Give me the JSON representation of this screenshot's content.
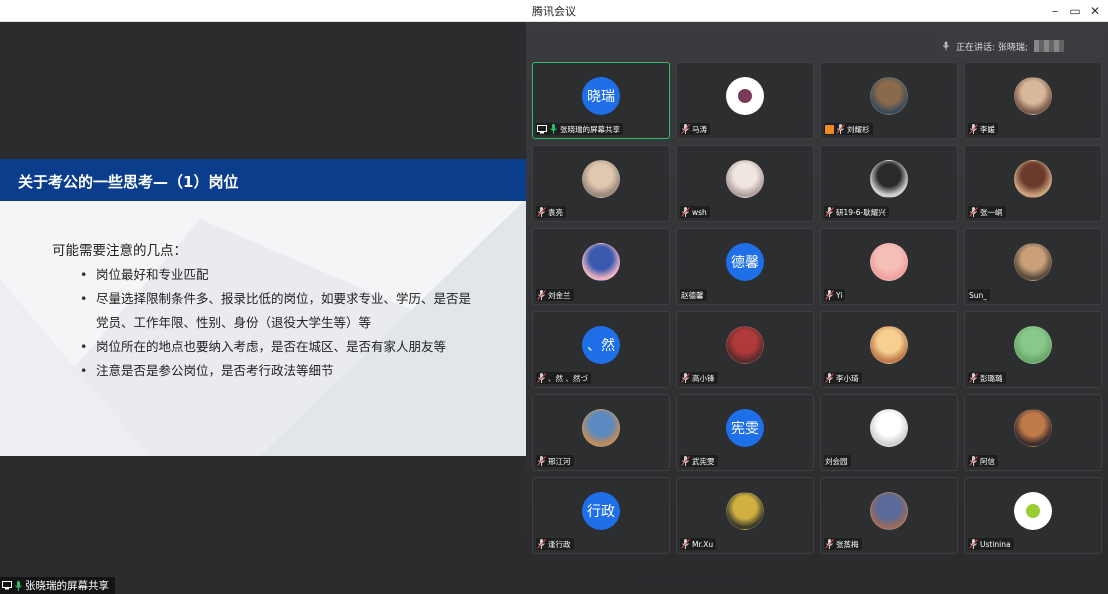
{
  "window": {
    "title": "腾讯会议",
    "minimize": "–",
    "restore": "▭",
    "close": "✕"
  },
  "share_tag": "张晓瑞的屏幕共享",
  "slide": {
    "title": "关于考公的一些思考—（1）岗位",
    "lead": "可能需要注意的几点：",
    "bullets": [
      "岗位最好和专业匹配",
      "尽量选择限制条件多、报录比低的岗位，如要求专业、学历、是否是党员、工作年限、性别、身份（退役大学生等）等",
      "岗位所在的地点也要纳入考虑，是否在城区、是否有家人朋友等",
      "注意是否是参公岗位，是否考行政法等细节"
    ]
  },
  "speaking": {
    "label": "正在讲话: 张晓瑞;"
  },
  "participants": [
    {
      "name": "张晓瑞的屏幕共享",
      "avatar_text": "晓瑞",
      "type": "text",
      "share": true,
      "mic": "green",
      "active": true
    },
    {
      "name": "马涛",
      "type": "white",
      "inner": "#7a3a5a",
      "mic": "muted"
    },
    {
      "name": "刘耀杉",
      "type": "pic",
      "c1": "#8a6a4a",
      "c2": "#3a4a5a",
      "mic": "muted",
      "badge": true
    },
    {
      "name": "李媛",
      "type": "pic",
      "c1": "#d9b89a",
      "c2": "#7a5a4a",
      "mic": "muted"
    },
    {
      "name": "袁亮",
      "type": "pic",
      "c1": "#e0c8b0",
      "c2": "#9a8a7a",
      "mic": "muted"
    },
    {
      "name": "wsh",
      "type": "pic",
      "c1": "#f0e6e0",
      "c2": "#b0a0a0",
      "mic": "muted"
    },
    {
      "name": "研19-6-耿耀兴",
      "type": "pic",
      "c1": "#2a2a2a",
      "c2": "#cfcfcf",
      "mic": "muted"
    },
    {
      "name": "张一峒",
      "type": "pic",
      "c1": "#6a3a2a",
      "c2": "#c9a07a",
      "mic": "muted"
    },
    {
      "name": "刘金兰",
      "type": "pic",
      "c1": "#3a5ab0",
      "c2": "#e8b0c0",
      "mic": "muted"
    },
    {
      "name": "赵德馨",
      "avatar_text": "德馨",
      "type": "text",
      "mic": "none"
    },
    {
      "name": "Yi",
      "type": "pic",
      "c1": "#f5c0b8",
      "c2": "#f0a0a0",
      "mic": "muted"
    },
    {
      "name": "Sun_",
      "type": "pic",
      "c1": "#c9a07a",
      "c2": "#5a4a3a",
      "mic": "none"
    },
    {
      "name": "、然 、然づ",
      "avatar_text": "、然",
      "type": "text",
      "mic": "muted"
    },
    {
      "name": "高小锋",
      "type": "pic",
      "c1": "#b03a3a",
      "c2": "#5a2a2a",
      "mic": "muted"
    },
    {
      "name": "李小琦",
      "type": "pic",
      "c1": "#f5d090",
      "c2": "#c07a4a",
      "mic": "muted"
    },
    {
      "name": "彭璐璐",
      "type": "pic",
      "c1": "#8ac88a",
      "c2": "#6aa86a",
      "mic": "muted"
    },
    {
      "name": "邢江河",
      "type": "pic",
      "c1": "#5a8ac0",
      "c2": "#c08a5a",
      "mic": "muted"
    },
    {
      "name": "武宪雯",
      "avatar_text": "宪雯",
      "type": "text",
      "mic": "muted"
    },
    {
      "name": "刘会园",
      "type": "pic",
      "c1": "#ffffff",
      "c2": "#d0d0d0",
      "mic": "none"
    },
    {
      "name": "阿信",
      "type": "pic",
      "c1": "#c07a4a",
      "c2": "#3a2a2a",
      "mic": "muted"
    },
    {
      "name": "逢行政",
      "avatar_text": "行政",
      "type": "text",
      "mic": "muted"
    },
    {
      "name": "Mr.Xu",
      "type": "pic",
      "c1": "#d0b040",
      "c2": "#3a3a2a",
      "mic": "muted"
    },
    {
      "name": "张蒸梅",
      "type": "pic",
      "c1": "#5a6a9a",
      "c2": "#9a6a5a",
      "mic": "muted"
    },
    {
      "name": "Ustinina",
      "type": "white",
      "inner": "#9acd32",
      "mic": "muted"
    }
  ],
  "colors": {
    "accent_blue": "#1e6fe8",
    "slide_header": "#0a3d8c",
    "active_border": "#2fbe6c",
    "mic_green": "#2fbe6c"
  }
}
